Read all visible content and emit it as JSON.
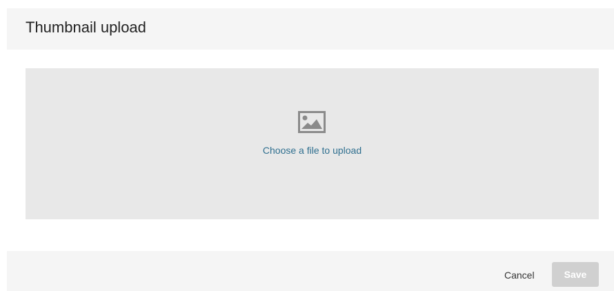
{
  "header": {
    "title": "Thumbnail upload"
  },
  "dropzone": {
    "icon": "image-placeholder-icon",
    "link_text": "Choose a file to upload"
  },
  "footer": {
    "cancel_label": "Cancel",
    "save_label": "Save",
    "save_enabled": false
  },
  "colors": {
    "header_bg": "#f5f5f5",
    "dropzone_bg": "#e8e8e8",
    "link": "#2f6f8f",
    "save_disabled_bg": "#d0d0d0",
    "icon": "#8a8a8a"
  }
}
